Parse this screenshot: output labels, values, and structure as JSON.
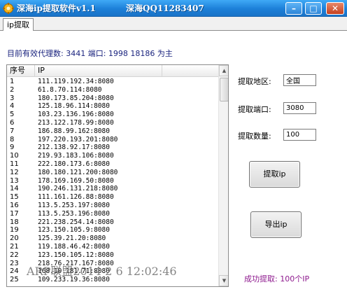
{
  "window": {
    "title": "深海ip提取软件v1.1",
    "title_qq": "深海QQ11283407",
    "min_glyph": "–",
    "max_glyph": "□",
    "close_glyph": "✕",
    "icon": "app-gear-icon"
  },
  "tabs": [
    {
      "label": "ip提取"
    }
  ],
  "status": {
    "text": "目前有效代理数: 3441  端口: 1998 18186 为主"
  },
  "list": {
    "headers": {
      "index": "序号",
      "ip": "IP"
    },
    "rows": [
      {
        "index": "1",
        "ip": "111.119.192.34:8080"
      },
      {
        "index": "2",
        "ip": "61.8.70.114:8080"
      },
      {
        "index": "3",
        "ip": "180.173.85.204:8080"
      },
      {
        "index": "4",
        "ip": "125.18.96.114:8080"
      },
      {
        "index": "5",
        "ip": "103.23.136.196:8080"
      },
      {
        "index": "6",
        "ip": "213.122.178.99:8080"
      },
      {
        "index": "7",
        "ip": "186.88.99.162:8080"
      },
      {
        "index": "8",
        "ip": "197.220.193.201:8080"
      },
      {
        "index": "9",
        "ip": "212.138.92.17:8080"
      },
      {
        "index": "10",
        "ip": "219.93.183.106:8080"
      },
      {
        "index": "11",
        "ip": "222.180.173.6:8080"
      },
      {
        "index": "12",
        "ip": "180.180.121.200:8080"
      },
      {
        "index": "13",
        "ip": "178.169.169.50:8080"
      },
      {
        "index": "14",
        "ip": "190.246.131.218:8080"
      },
      {
        "index": "15",
        "ip": "111.161.126.88:8080"
      },
      {
        "index": "16",
        "ip": "113.5.253.197:8080"
      },
      {
        "index": "17",
        "ip": "113.5.253.196:8080"
      },
      {
        "index": "18",
        "ip": "221.238.254.14:8080"
      },
      {
        "index": "19",
        "ip": "123.150.105.9:8080"
      },
      {
        "index": "20",
        "ip": "125.39.21.20:8080"
      },
      {
        "index": "21",
        "ip": "119.188.46.42:8080"
      },
      {
        "index": "22",
        "ip": "123.150.105.12:8080"
      },
      {
        "index": "23",
        "ip": "218.76.217.167:8080"
      },
      {
        "index": "24",
        "ip": "168.10.181.71:8080"
      },
      {
        "index": "25",
        "ip": "109.233.19.36:8080"
      }
    ]
  },
  "form": {
    "region_label": "提取地区:",
    "region_value": "全国",
    "port_label": "提取端口:",
    "port_value": "3080",
    "count_label": "提取数量:",
    "count_value": "100"
  },
  "buttons": {
    "fetch": "提取ip",
    "export": "导出ip"
  },
  "result": {
    "text": "成功提取: 100个IP"
  },
  "watermark": {
    "text": "ARP联盟2014 2 6 12:02:46"
  }
}
